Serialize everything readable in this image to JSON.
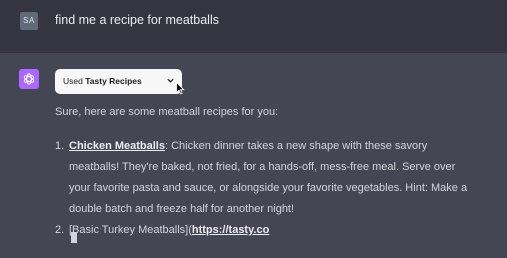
{
  "user": {
    "avatar_initials": "SA",
    "message": "find me a recipe for meatballs"
  },
  "assistant": {
    "avatar_icon": "openai-logo-icon",
    "avatar_color": "#ab68ff",
    "plugin_prefix": "Used ",
    "plugin_name": "Tasty Recipes",
    "plugin_dropdown_icon": "chevron-down-icon",
    "intro": "Sure, here are some meatball recipes for you:",
    "items": [
      {
        "number": "1.",
        "link": "Chicken Meatballs",
        "text": ": Chicken dinner takes a new shape with these savory meatballs! They're baked, not fried, for a hands-off, mess-free meal. Serve over your favorite pasta and sauce, or alongside your favorite vegetables. Hint: Make a double batch and freeze half for another night!"
      },
      {
        "number": "2.",
        "prefix": "[Basic Turkey Meatballs](",
        "link": "https://tasty.co"
      }
    ]
  },
  "colors": {
    "user_row_bg": "#343541",
    "assistant_row_bg": "#444654"
  }
}
